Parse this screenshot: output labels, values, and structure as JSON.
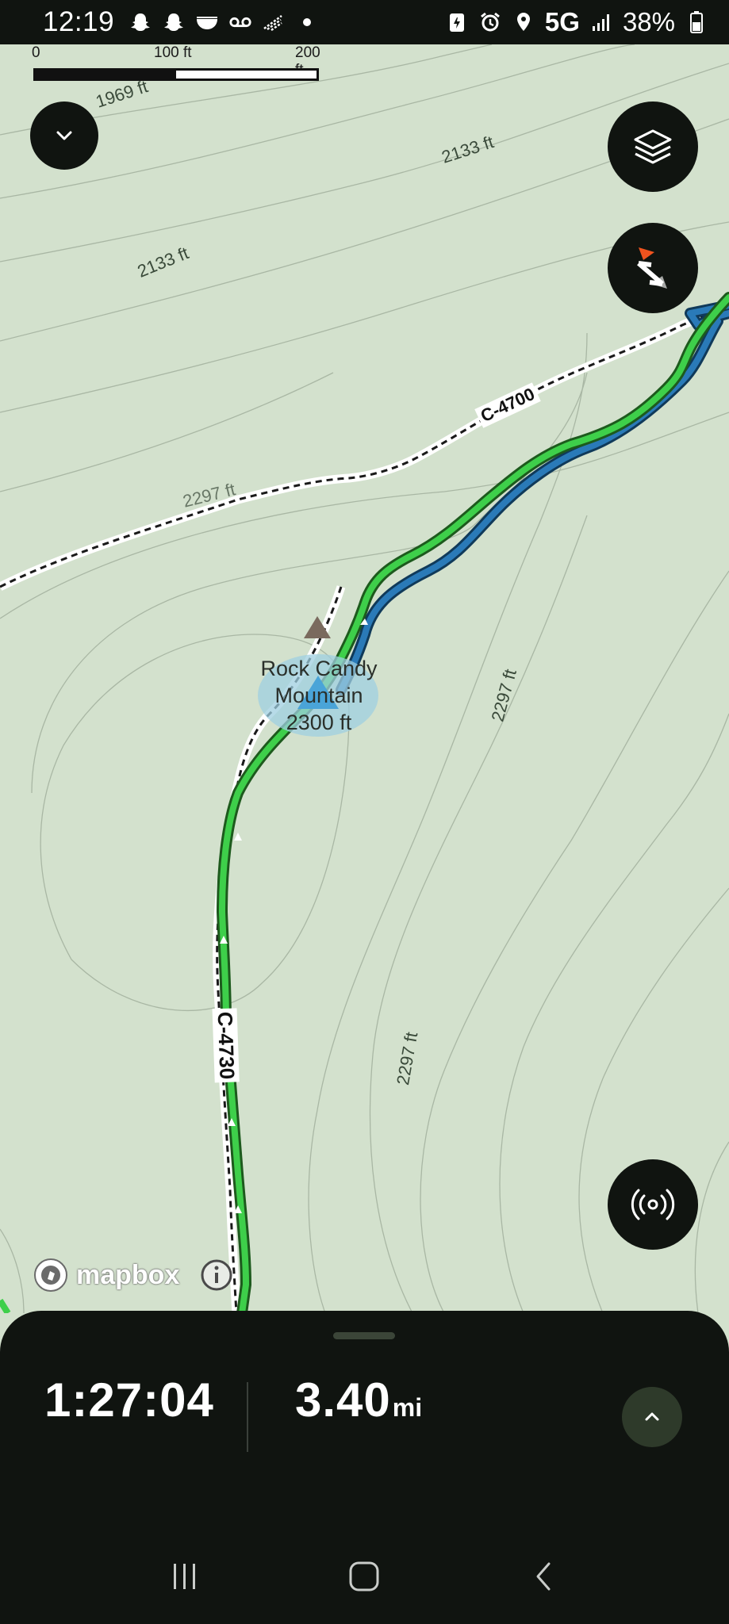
{
  "status_bar": {
    "time": "12:19",
    "network": "5G",
    "battery": "38%",
    "left_icons": [
      "snapchat-icon",
      "snapchat-icon",
      "bowl-icon",
      "voicemail-icon",
      "wifi-calling-icon",
      "dot-icon"
    ],
    "right_icons": [
      "battery-saver-icon",
      "alarm-icon",
      "location-icon",
      "signal-icon",
      "battery-icon"
    ]
  },
  "scale": {
    "label_0": "0",
    "label_100": "100 ft",
    "label_200": "200 ft"
  },
  "map": {
    "contours": {
      "c1969": "1969 ft",
      "c2133a": "2133 ft",
      "c2133b": "2133 ft",
      "c2297a": "2297 ft",
      "c2297b": "2297 ft",
      "c2297c": "2297 ft"
    },
    "roads": {
      "road_a": "C-4700",
      "road_b": "C-4730"
    },
    "peak": {
      "name": "Rock Candy Mountain",
      "elevation": "2300 ft"
    },
    "attribution": "mapbox",
    "colors": {
      "track_green": "#3ecf4a",
      "track_blue": "#2a7ab8",
      "background": "#d3e1cd"
    }
  },
  "buttons": {
    "collapse_icon": "chevron-down-icon",
    "layers_icon": "layers-icon",
    "compass_icon": "compass-icon",
    "gps_icon": "broadcast-icon"
  },
  "recording": {
    "elapsed_time": "1:27:04",
    "distance_value": "3.40",
    "distance_unit": "mi"
  },
  "nav_bar": {
    "icons": [
      "recents-icon",
      "home-icon",
      "back-icon"
    ]
  }
}
